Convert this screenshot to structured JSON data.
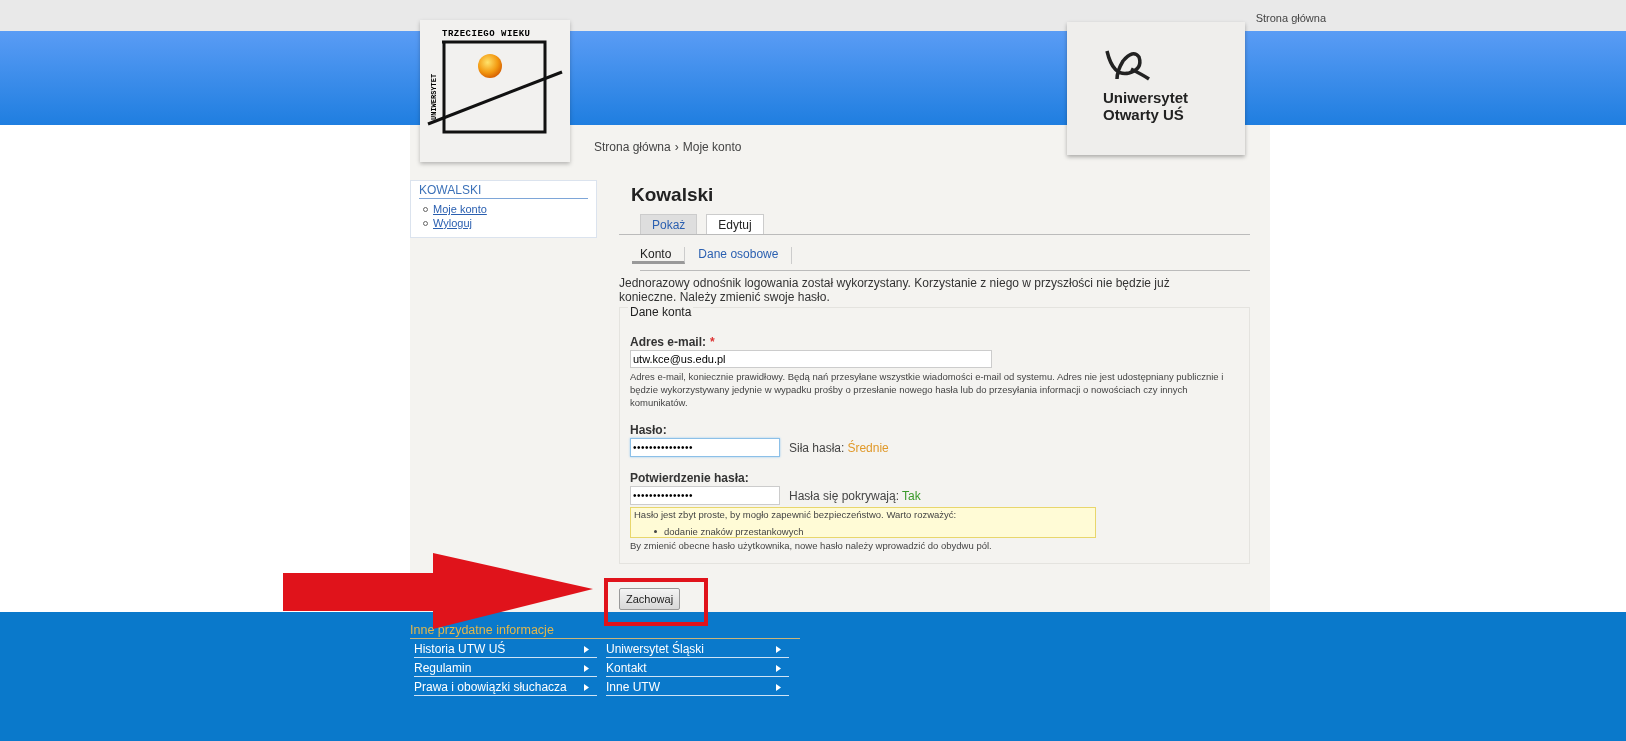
{
  "top_link": "Strona główna",
  "logo_left": {
    "arc_text": "TRZECIEGO WIEKU",
    "side_text": "UNIWERSYTET"
  },
  "logo_right": {
    "lines": [
      "Uniwersytet",
      "Otwarty UŚ"
    ]
  },
  "breadcrumb": {
    "items": [
      "Strona główna",
      "Moje konto"
    ],
    "separator": "›"
  },
  "sidebar": {
    "title": "KOWALSKI",
    "items": [
      "Moje konto",
      "Wyloguj"
    ]
  },
  "page_title": "Kowalski",
  "tabs": [
    {
      "label": "Pokaż",
      "selected": false
    },
    {
      "label": "Edytuj",
      "selected": true
    }
  ],
  "subtabs": [
    {
      "label": "Konto",
      "selected": true
    },
    {
      "label": "Dane osobowe",
      "selected": false
    }
  ],
  "message": "Jednorazowy odnośnik logowania został wykorzystany. Korzystanie z niego w przyszłości nie będzie już konieczne. Należy zmienić swoje hasło.",
  "fieldset": {
    "legend": "Dane konta",
    "email": {
      "label": "Adres e-mail:",
      "required": true,
      "required_mark": "*",
      "value": "utw.kce@us.edu.pl",
      "description": "Adres e-mail, koniecznie prawidłowy. Będą nań przesyłane wszystkie wiadomości e-mail od systemu. Adres nie jest udostępniany publicznie i będzie wykorzystywany jedynie w wypadku prośby o przesłanie nowego hasła lub do przesyłania informacji o nowościach czy innych komunikatów."
    },
    "password": {
      "label": "Hasło:",
      "value": "•••••••••••••••",
      "focused": true,
      "status_label": "Siła hasła:",
      "status_value": "Średnie",
      "kind": "medium"
    },
    "confirm": {
      "label": "Potwierdzenie hasła:",
      "value": "•••••••••••••••",
      "focused": false,
      "status_label": "Hasła się pokrywają:",
      "status_value": "Tak",
      "kind": "ok"
    },
    "warning": {
      "text": "Hasło jest zbyt proste, by mogło zapewnić bezpieczeństwo. Warto rozważyć:",
      "items": [
        "dodanie znaków przestankowych"
      ]
    },
    "hint": "By zmienić obecne hasło użytkownika, nowe hasło należy wprowadzić do obydwu pól."
  },
  "save_button": "Zachowaj",
  "footer": {
    "title": "Inne przydatne informacje",
    "rows": [
      [
        "Historia UTW UŚ",
        "Uniwersytet Śląski"
      ],
      [
        "Regulamin",
        "Kontakt"
      ],
      [
        "Prawa i obowiązki słuchacza",
        "Inne UTW"
      ]
    ]
  }
}
